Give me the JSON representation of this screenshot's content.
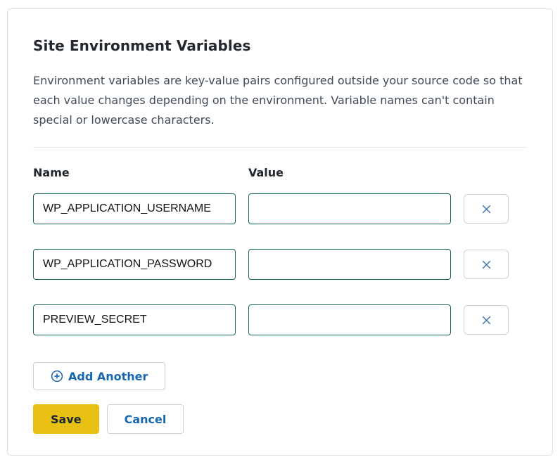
{
  "card": {
    "title": "Site Environment Variables",
    "description": "Environment variables are key-value pairs configured outside your source code so that each value changes depending on the environment. Variable names can't contain special or lowercase characters.",
    "columns": {
      "name": "Name",
      "value": "Value"
    },
    "rows": [
      {
        "name": "WP_APPLICATION_USERNAME",
        "value": ""
      },
      {
        "name": "WP_APPLICATION_PASSWORD",
        "value": ""
      },
      {
        "name": "PREVIEW_SECRET",
        "value": ""
      }
    ],
    "icons": {
      "remove": "close-x-icon",
      "add": "plus-circle-icon"
    },
    "add_button_label": "Add Another",
    "save_button_label": "Save",
    "cancel_button_label": "Cancel"
  },
  "colors": {
    "input_border_green": "#176e4a",
    "accent_blue": "#1766b1",
    "close_icon_blue": "#4b80b4",
    "save_yellow": "#e8c013",
    "save_text": "#1a2732",
    "text_dark": "#23282d",
    "text_slate": "#404b58",
    "card_border": "#dadfe4",
    "button_border": "#c9d1d9",
    "divider": "#e2e6ea"
  }
}
